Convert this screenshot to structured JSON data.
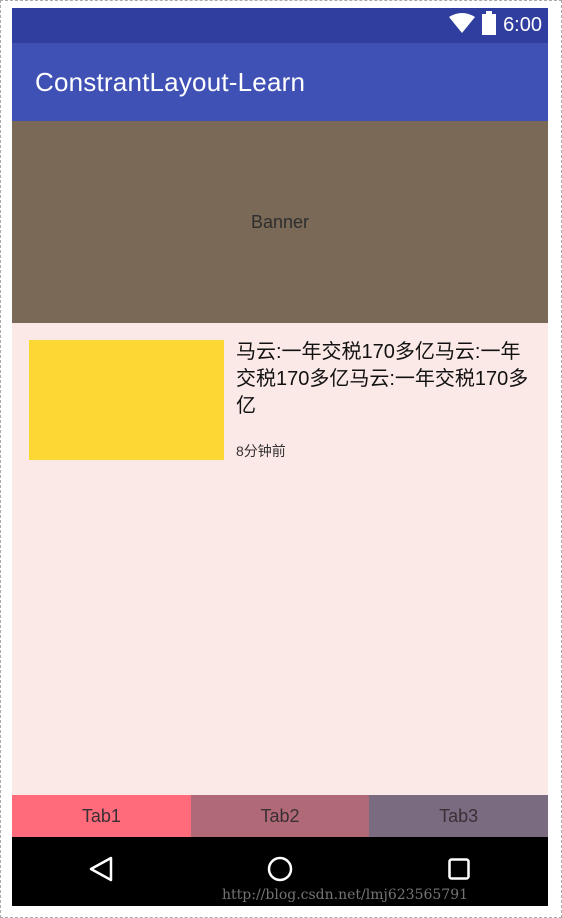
{
  "status_bar": {
    "time": "6:00",
    "icons": [
      "wifi-icon",
      "battery-icon"
    ]
  },
  "app_bar": {
    "title": "ConstrantLayout-Learn"
  },
  "banner": {
    "text": "Banner"
  },
  "news": {
    "title": "马云:一年交税170多亿马云:一年交税170多亿马云:一年交税170多亿",
    "time": "8分钟前"
  },
  "tabs": [
    {
      "label": "Tab1"
    },
    {
      "label": "Tab2"
    },
    {
      "label": "Tab3"
    }
  ],
  "nav_bar": {
    "icons": [
      "back-icon",
      "home-icon",
      "recents-icon"
    ]
  },
  "watermark": "http://blog.csdn.net/lmj623565791",
  "colors": {
    "status_bar": "#303f9f",
    "app_bar": "#3f51b5",
    "banner": "#796956",
    "content_bg": "#fbe9e7",
    "thumbnail": "#fdd835",
    "tab1": "#ff6b7a",
    "tab2": "#b06a77",
    "tab3": "#7b6b80"
  }
}
